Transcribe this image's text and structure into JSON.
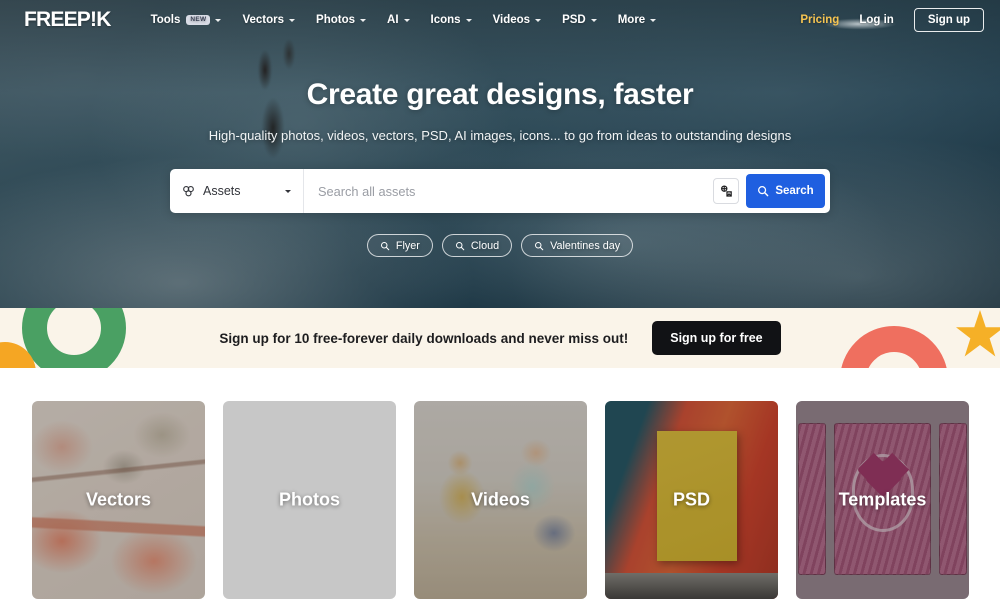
{
  "header": {
    "logo": "FREEP!K",
    "nav": [
      {
        "label": "Tools",
        "badge": "NEW",
        "has_caret": true
      },
      {
        "label": "Vectors",
        "badge": "",
        "has_caret": true
      },
      {
        "label": "Photos",
        "badge": "",
        "has_caret": true
      },
      {
        "label": "AI",
        "badge": "",
        "has_caret": true
      },
      {
        "label": "Icons",
        "badge": "",
        "has_caret": true
      },
      {
        "label": "Videos",
        "badge": "",
        "has_caret": true
      },
      {
        "label": "PSD",
        "badge": "",
        "has_caret": true
      },
      {
        "label": "More",
        "badge": "",
        "has_caret": true
      }
    ],
    "pricing": "Pricing",
    "login": "Log in",
    "signup": "Sign up"
  },
  "hero": {
    "title": "Create great designs, faster",
    "subtitle": "High-quality photos, videos, vectors, PSD, AI images, icons... to go from ideas to outstanding designs",
    "search": {
      "category": "Assets",
      "placeholder": "Search all assets",
      "value": "",
      "image_search_icon": "image-search-icon",
      "button_label": "Search"
    },
    "chips": [
      {
        "label": "Flyer"
      },
      {
        "label": "Cloud"
      },
      {
        "label": "Valentines day"
      }
    ]
  },
  "promo": {
    "text": "Sign up for 10 free-forever daily downloads and never miss out!",
    "button": "Sign up for free"
  },
  "categories": [
    {
      "label": "Vectors"
    },
    {
      "label": "Photos"
    },
    {
      "label": "Videos"
    },
    {
      "label": "PSD"
    },
    {
      "label": "Templates"
    }
  ],
  "colors": {
    "accent_blue": "#1f5fe0",
    "pricing_gold": "#f5c451",
    "promo_bg": "#faf4e9",
    "promo_btn": "#111215",
    "deco_green": "#4aa063",
    "deco_orange": "#f5a623",
    "deco_coral": "#ef6f5f",
    "deco_yellow": "#f5b027"
  }
}
